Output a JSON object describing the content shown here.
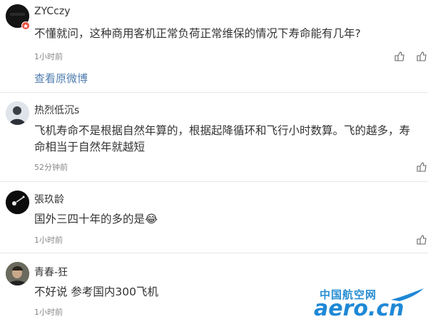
{
  "comments": [
    {
      "user": "ZYCczy",
      "text": "不懂就问，这种商用客机正常负荷正常维保的情况下寿命能有几年?",
      "time": "1小时前",
      "link": "查看原微博"
    },
    {
      "user": "热烈低沉s",
      "text": "飞机寿命不是根据自然年算的，根据起降循环和飞行小时数算。飞的越多，寿命相当于自然年就越短",
      "time": "52分钟前"
    },
    {
      "user": "張玖龄",
      "text": "国外三四十年的多的是😂",
      "time": "1小时前"
    },
    {
      "user": "青春-狂",
      "text": "不好说 参考国内300飞机",
      "time": "1小时前"
    }
  ],
  "watermark": {
    "cn": "中国航空网",
    "en": "aero.cn"
  },
  "colors": {
    "link": "#507daf",
    "watermark": "#1e88d6",
    "divider": "#e6e6e6"
  },
  "icons": [
    "avatar",
    "like-icon",
    "reply-icon",
    "vip-badge-icon"
  ]
}
